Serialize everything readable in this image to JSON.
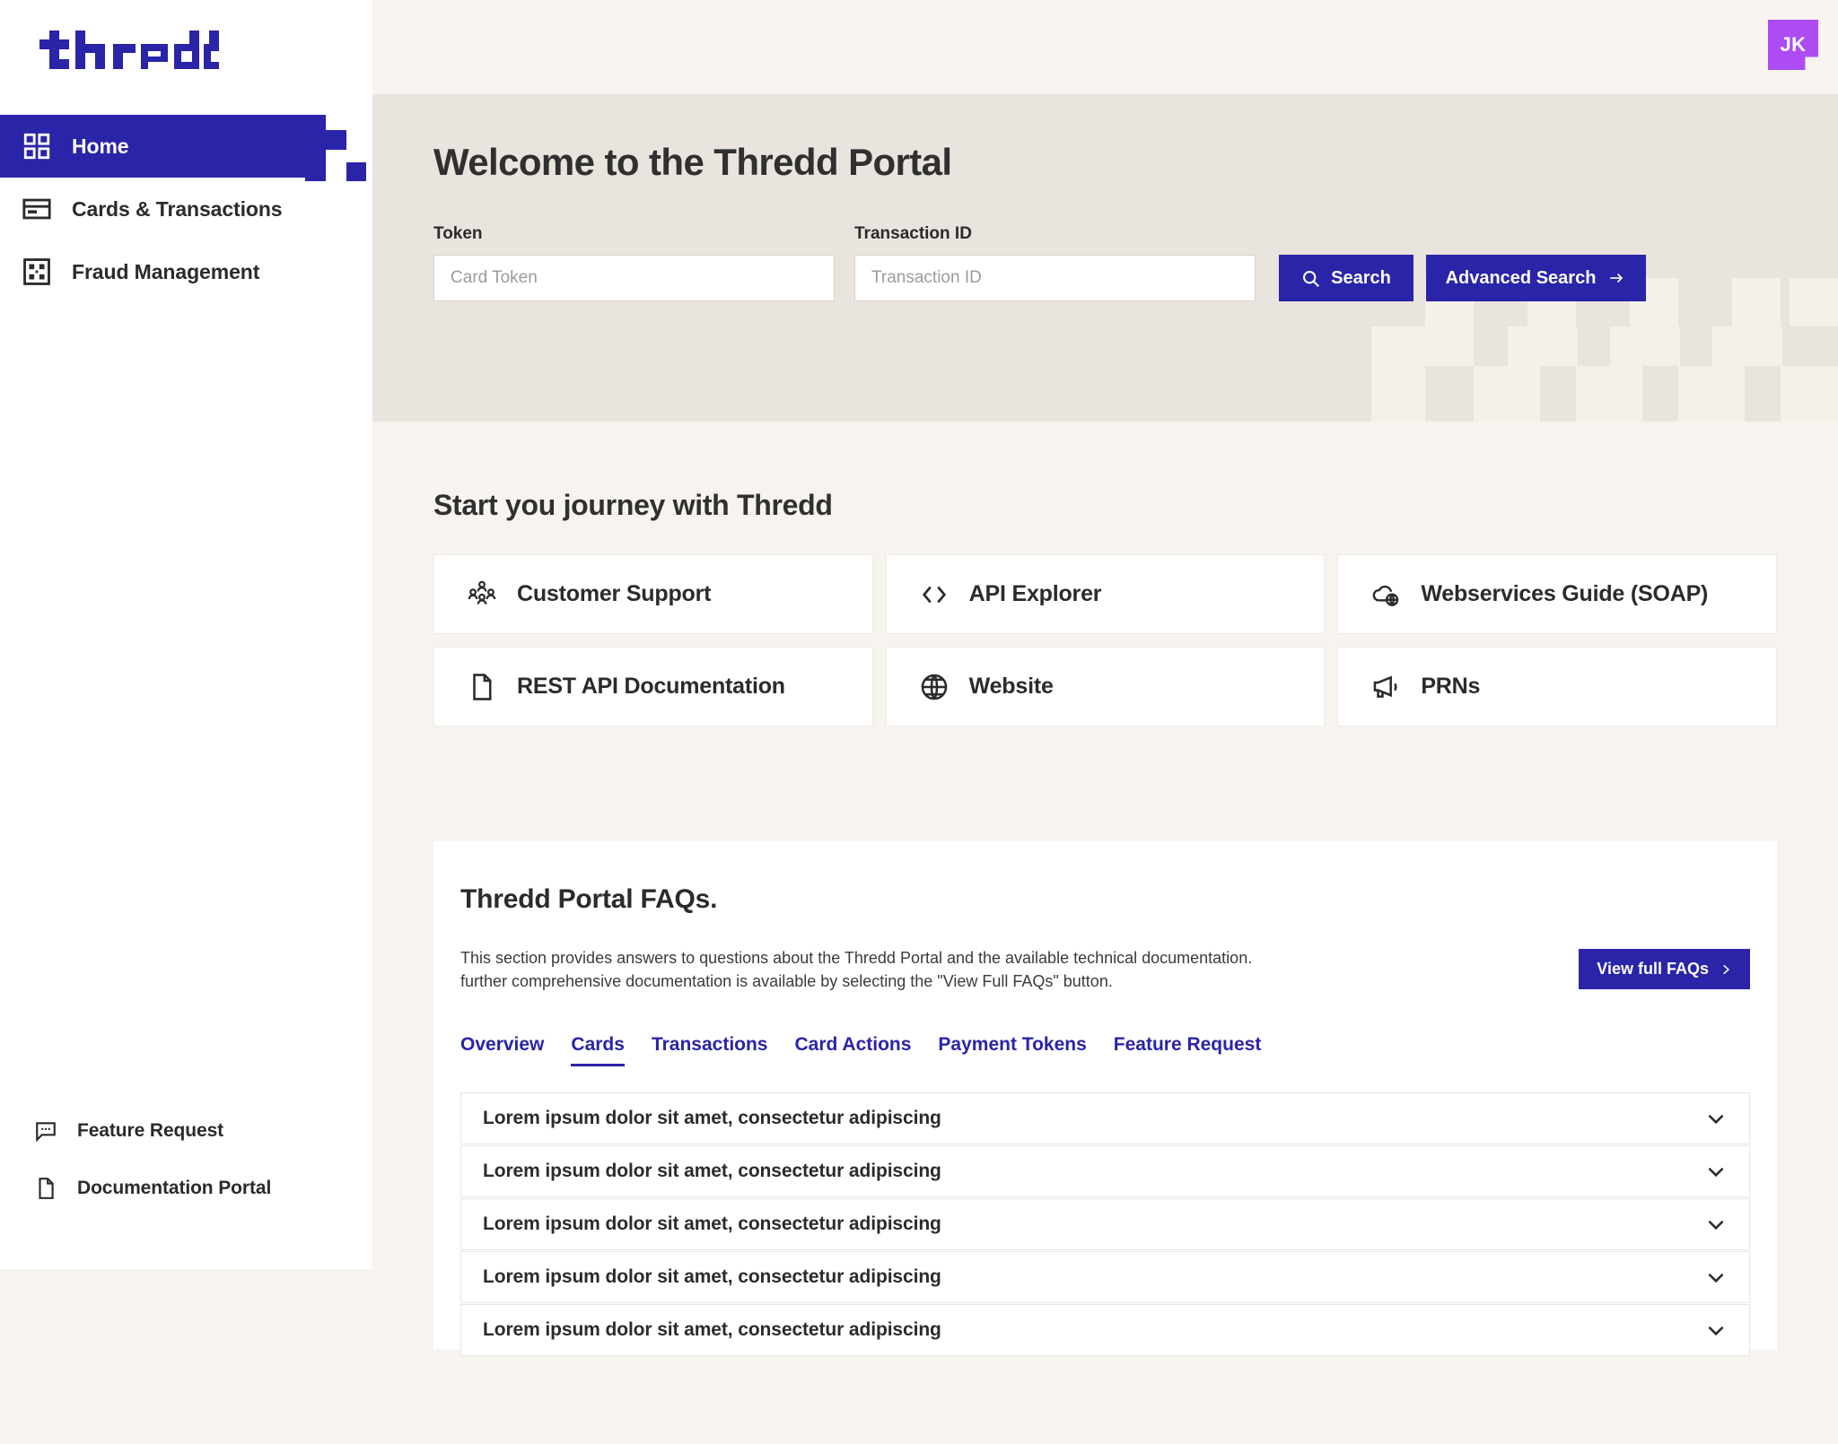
{
  "brand": {
    "logo_text": "thredd",
    "primary_color": "#2a24a8",
    "hero_bg": "#e9e4dd",
    "page_bg": "#f7f3ef",
    "avatar_color": "#ad4cf2"
  },
  "account": {
    "initials": "JK"
  },
  "sidebar": {
    "top_items": [
      {
        "label": "Home",
        "icon": "grid-icon",
        "active": true
      },
      {
        "label": "Cards & Transactions",
        "icon": "credit-card-icon",
        "active": false
      },
      {
        "label": "Fraud Management",
        "icon": "fraud-shield-icon",
        "active": false
      }
    ],
    "bottom_items": [
      {
        "label": "Feature Request",
        "icon": "comment-icon"
      },
      {
        "label": "Documentation Portal",
        "icon": "document-icon"
      }
    ]
  },
  "hero": {
    "title": "Welcome to the Thredd Portal",
    "token_label": "Token",
    "token_placeholder": "Card Token",
    "token_value": "",
    "txn_label": "Transaction ID",
    "txn_placeholder": "Transaction ID",
    "txn_value": "",
    "search_button": "Search",
    "advanced_button": "Advanced Search",
    "search_icon": "search-icon",
    "arrow_icon": "arrow-right-icon"
  },
  "journey": {
    "title": "Start you journey with Thredd",
    "cards": [
      {
        "label": "Customer Support",
        "icon": "people-group-icon"
      },
      {
        "label": "API Explorer",
        "icon": "code-brackets-icon"
      },
      {
        "label": "Webservices Guide (SOAP)",
        "icon": "cloud-globe-icon"
      },
      {
        "label": "REST API Documentation",
        "icon": "document-icon"
      },
      {
        "label": "Website",
        "icon": "globe-icon"
      },
      {
        "label": "PRNs",
        "icon": "megaphone-icon"
      }
    ]
  },
  "faq": {
    "title": "Thredd Portal FAQs.",
    "description_line1": "This section provides answers to questions about the Thredd Portal and the available technical documentation.",
    "description_line2": "further comprehensive documentation is available by selecting the \"View Full FAQs\" button.",
    "view_full_button": "View full FAQs",
    "chevron_right_icon": "chevron-right-icon",
    "tabs": [
      {
        "label": "Overview",
        "active": false
      },
      {
        "label": "Cards",
        "active": true
      },
      {
        "label": "Transactions",
        "active": false
      },
      {
        "label": "Card Actions",
        "active": false
      },
      {
        "label": "Payment Tokens",
        "active": false
      },
      {
        "label": "Feature Request",
        "active": false
      }
    ],
    "items": [
      {
        "question": "Lorem ipsum dolor sit amet, consectetur adipiscing",
        "icon": "chevron-down-icon"
      },
      {
        "question": "Lorem ipsum dolor sit amet, consectetur adipiscing",
        "icon": "chevron-down-icon"
      },
      {
        "question": "Lorem ipsum dolor sit amet, consectetur adipiscing",
        "icon": "chevron-down-icon"
      },
      {
        "question": "Lorem ipsum dolor sit amet, consectetur adipiscing",
        "icon": "chevron-down-icon"
      },
      {
        "question": "Lorem ipsum dolor sit amet, consectetur adipiscing",
        "icon": "chevron-down-icon"
      }
    ]
  }
}
